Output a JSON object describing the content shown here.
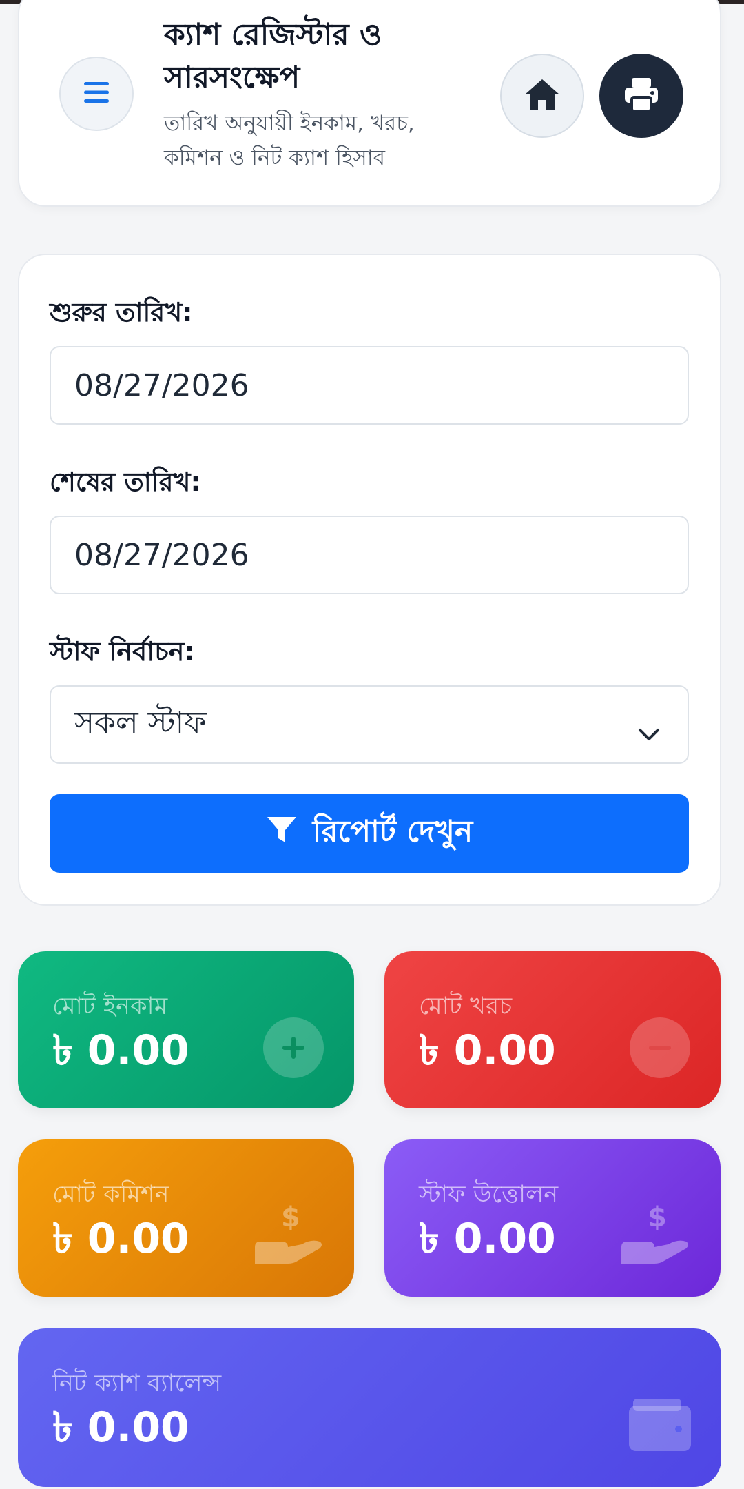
{
  "header": {
    "title": "ক্যাশ রেজিস্টার ও সারসংক্ষেপ",
    "subtitle": "তারিখ অনুযায়ী ইনকাম, খরচ, কমিশন ও নিট ক্যাশ হিসাব",
    "menu_icon": "menu-icon",
    "home_icon": "home-icon",
    "print_icon": "printer-icon"
  },
  "filters": {
    "start_label": "শুরুর তারিখ:",
    "start_value": "08/27/2026",
    "end_label": "শেষের তারিখ:",
    "end_value": "08/27/2026",
    "staff_label": "স্টাফ নির্বাচন:",
    "staff_value": "সকল স্টাফ",
    "report_button": "রিপোর্ট দেখুন"
  },
  "stats": {
    "income": {
      "label": "মোট ইনকাম",
      "value": "৳ 0.00",
      "color": "#10b981",
      "icon": "plus-icon"
    },
    "expense": {
      "label": "মোট খরচ",
      "value": "৳ 0.00",
      "color": "#ef4444",
      "icon": "minus-icon"
    },
    "commission": {
      "label": "মোট কমিশন",
      "value": "৳ 0.00",
      "color": "#f59e0b",
      "icon": "hand-dollar-icon"
    },
    "withdrawal": {
      "label": "স্টাফ উত্তোলন",
      "value": "৳ 0.00",
      "color": "#8b5cf6",
      "icon": "hand-dollar-icon"
    },
    "net": {
      "label": "নিট ক্যাশ ব্যালেন্স",
      "value": "৳ 0.00",
      "color": "#6366f1",
      "icon": "wallet-icon"
    }
  },
  "colors": {
    "primary": "#0d6efd",
    "dark": "#1e293b"
  }
}
